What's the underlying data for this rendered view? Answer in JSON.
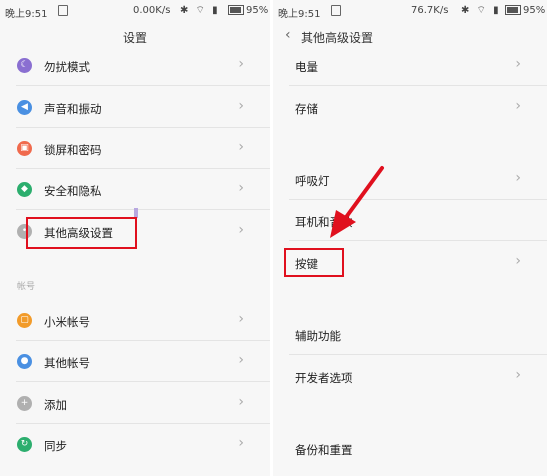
{
  "left": {
    "status": {
      "time": "晚上9:51",
      "speed": "0.00K/s",
      "battery": "95%"
    },
    "title": "设置",
    "items": [
      {
        "label": "勿扰模式",
        "icon": "moon-icon",
        "color": "#8a6fd1"
      },
      {
        "label": "声音和振动",
        "icon": "speaker-icon",
        "color": "#4a90e2"
      },
      {
        "label": "锁屏和密码",
        "icon": "lock-icon",
        "color": "#f06a4d"
      },
      {
        "label": "安全和隐私",
        "icon": "shield-icon",
        "color": "#2cae6e"
      },
      {
        "label": "其他高级设置",
        "icon": "more-icon",
        "color": "#b0b0b0"
      }
    ],
    "section": "帐号",
    "items2": [
      {
        "label": "小米帐号",
        "icon": "mi-icon",
        "color": "#f29b2a"
      },
      {
        "label": "其他帐号",
        "icon": "person-icon",
        "color": "#4a90e2"
      },
      {
        "label": "添加",
        "icon": "plus-icon",
        "color": "#b0b0b0"
      },
      {
        "label": "同步",
        "icon": "sync-icon",
        "color": "#2cae6e"
      }
    ]
  },
  "right": {
    "status": {
      "time": "晚上9:51",
      "speed": "76.7K/s",
      "battery": "95%"
    },
    "title": "其他高级设置",
    "items": [
      {
        "label": "电量",
        "chevron": true
      },
      {
        "label": "存储",
        "chevron": true
      },
      {
        "label": "呼吸灯",
        "chevron": true
      },
      {
        "label": "耳机和音效",
        "chevron": false
      },
      {
        "label": "按键",
        "chevron": true
      },
      {
        "label": "辅助功能",
        "chevron": false
      },
      {
        "label": "开发者选项",
        "chevron": true
      },
      {
        "label": "备份和重置",
        "chevron": false
      }
    ]
  },
  "colors": {
    "highlight": "#e0101e",
    "background": "#f7f7f7"
  },
  "chevron_glyph": "›",
  "back_glyph": "‹"
}
